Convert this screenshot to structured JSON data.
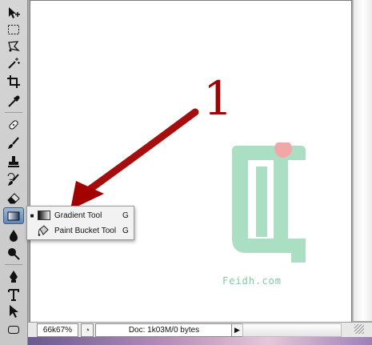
{
  "toolbar": {
    "tools": [
      {
        "name": "move-tool",
        "icon": "move-icon"
      },
      {
        "name": "marquee-tool",
        "icon": "rectangular-marquee-icon"
      },
      {
        "name": "lasso-tool",
        "icon": "polygonal-lasso-icon"
      },
      {
        "name": "magic-wand-tool",
        "icon": "magic-wand-icon"
      },
      {
        "name": "crop-tool",
        "icon": "crop-icon"
      },
      {
        "name": "eyedropper-tool",
        "icon": "eyedropper-icon"
      },
      {
        "name": "healing-brush-tool",
        "icon": "healing-brush-icon"
      },
      {
        "name": "brush-tool",
        "icon": "brush-icon"
      },
      {
        "name": "clone-stamp-tool",
        "icon": "clone-stamp-icon"
      },
      {
        "name": "history-brush-tool",
        "icon": "history-brush-icon"
      },
      {
        "name": "eraser-tool",
        "icon": "eraser-icon"
      },
      {
        "name": "gradient-tool",
        "icon": "gradient-icon",
        "active": true
      },
      {
        "name": "blur-tool",
        "icon": "blur-icon"
      },
      {
        "name": "dodge-tool",
        "icon": "dodge-icon"
      },
      {
        "name": "pen-tool",
        "icon": "pen-icon"
      },
      {
        "name": "type-tool",
        "icon": "type-icon"
      },
      {
        "name": "path-selection-tool",
        "icon": "arrow-icon"
      },
      {
        "name": "shape-tool",
        "icon": "rounded-rectangle-icon"
      }
    ]
  },
  "flyout": {
    "items": [
      {
        "label": "Gradient Tool",
        "shortcut": "G",
        "selected": true,
        "icon": "gradient-icon"
      },
      {
        "label": "Paint Bucket Tool",
        "shortcut": "G",
        "selected": false,
        "icon": "paint-bucket-icon"
      }
    ],
    "bullet": "■"
  },
  "status": {
    "zoom": "66k67%",
    "doc_info": "Doc: 1k03M/0 bytes",
    "arrow": "▶"
  },
  "annotation": {
    "number": "1",
    "color": "#a30000"
  },
  "watermark": {
    "text": "Feidh.com",
    "green": "#8fd4b0",
    "dot": "#f3a6a6"
  }
}
